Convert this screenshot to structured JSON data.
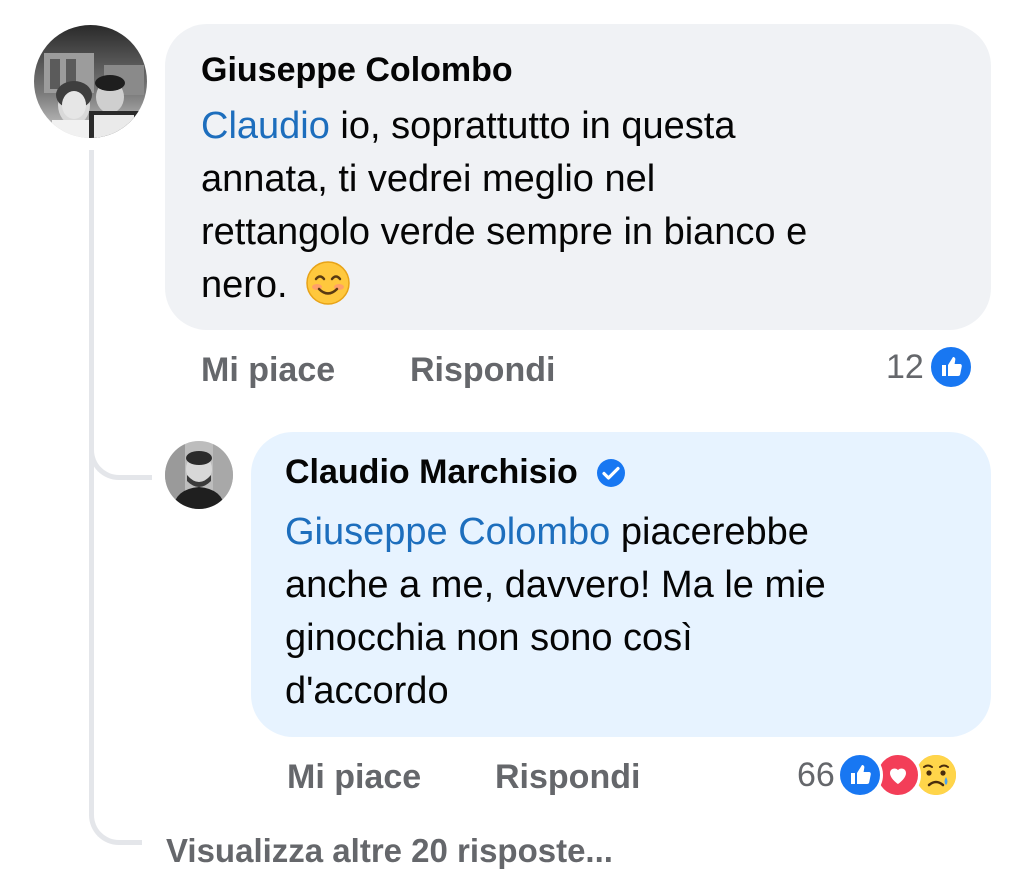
{
  "comments": [
    {
      "author": "Giuseppe Colombo",
      "mention": "Claudio",
      "text_lines": [
        " io, soprattutto in questa",
        "annata, ti vedrei meglio nel",
        "rettangolo verde sempre in bianco e",
        "nero. "
      ],
      "emoji": "smiling-face-icon",
      "like_label": "Mi piace",
      "reply_label": "Rispondi",
      "reaction_count": "12",
      "reactions": [
        "like-reaction-icon"
      ]
    },
    {
      "author": "Claudio Marchisio",
      "verified": true,
      "mention": "Giuseppe Colombo",
      "text_lines": [
        " piacerebbe",
        "anche a me, davvero! Ma le mie",
        "ginocchia non sono così",
        "d'accordo"
      ],
      "like_label": "Mi piace",
      "reply_label": "Rispondi",
      "reaction_count": "66",
      "reactions": [
        "like-reaction-icon",
        "love-reaction-icon",
        "sad-reaction-icon"
      ]
    }
  ],
  "more_replies": "Visualizza altre 20 risposte...",
  "colors": {
    "mention": "#1d6ebd",
    "like_blue": "#1877f2",
    "love_red": "#f33e58",
    "bubble_gray": "#f0f2f5",
    "bubble_blue": "#e7f3ff",
    "meta_gray": "#65676b"
  }
}
